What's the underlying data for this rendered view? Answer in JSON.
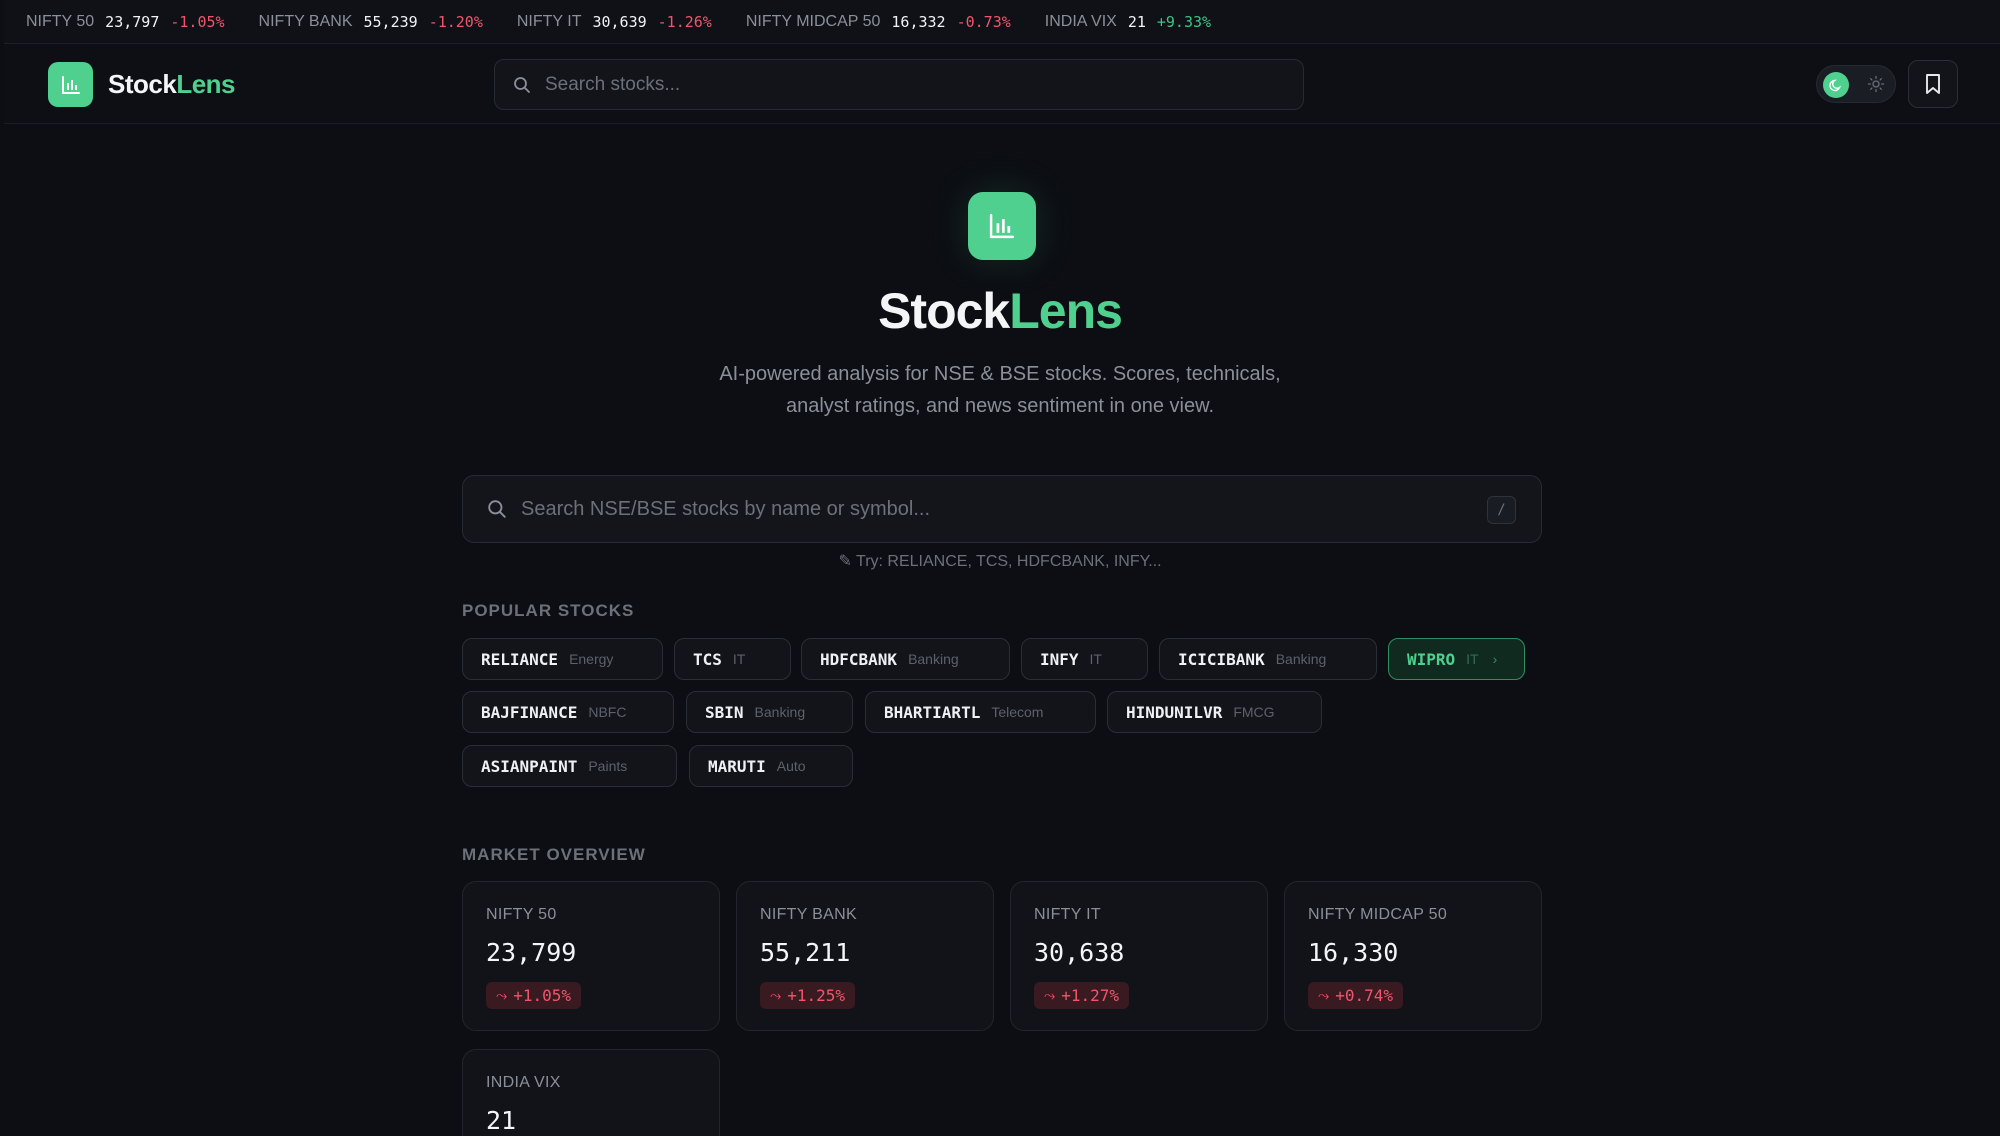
{
  "ticker": [
    {
      "name": "NIFTY 50",
      "value": "23,797",
      "change": "-1.05%",
      "dir": "neg"
    },
    {
      "name": "NIFTY BANK",
      "value": "55,239",
      "change": "-1.20%",
      "dir": "neg"
    },
    {
      "name": "NIFTY IT",
      "value": "30,639",
      "change": "-1.26%",
      "dir": "neg"
    },
    {
      "name": "NIFTY MIDCAP 50",
      "value": "16,332",
      "change": "-0.73%",
      "dir": "neg"
    },
    {
      "name": "INDIA VIX",
      "value": "21",
      "change": "+9.33%",
      "dir": "pos"
    }
  ],
  "header": {
    "brand_a": "Stock",
    "brand_b": "Lens",
    "search_placeholder": "Search stocks..."
  },
  "hero": {
    "title_a": "Stock",
    "title_b": "Lens",
    "subtitle": "AI-powered analysis for NSE & BSE stocks. Scores, technicals, analyst ratings, and news sentiment in one view.",
    "search_placeholder": "Search NSE/BSE stocks by name or symbol...",
    "shortcut": "/",
    "hint": "✎ Try: RELIANCE, TCS, HDFCBANK, INFY..."
  },
  "popular": {
    "label": "POPULAR STOCKS",
    "stocks": [
      {
        "symbol": "RELIANCE",
        "sector": "Energy"
      },
      {
        "symbol": "TCS",
        "sector": "IT"
      },
      {
        "symbol": "HDFCBANK",
        "sector": "Banking"
      },
      {
        "symbol": "INFY",
        "sector": "IT"
      },
      {
        "symbol": "ICICIBANK",
        "sector": "Banking"
      },
      {
        "symbol": "WIPRO",
        "sector": "IT"
      },
      {
        "symbol": "BAJFINANCE",
        "sector": "NBFC"
      },
      {
        "symbol": "SBIN",
        "sector": "Banking"
      },
      {
        "symbol": "BHARTIARTL",
        "sector": "Telecom"
      },
      {
        "symbol": "HINDUNILVR",
        "sector": "FMCG"
      },
      {
        "symbol": "ASIANPAINT",
        "sector": "Paints"
      },
      {
        "symbol": "MARUTI",
        "sector": "Auto"
      }
    ]
  },
  "market": {
    "label": "MARKET OVERVIEW",
    "cards": [
      {
        "name": "NIFTY 50",
        "value": "23,799",
        "change": "+1.05%"
      },
      {
        "name": "NIFTY BANK",
        "value": "55,211",
        "change": "+1.25%"
      },
      {
        "name": "NIFTY IT",
        "value": "30,638",
        "change": "+1.27%"
      },
      {
        "name": "NIFTY MIDCAP 50",
        "value": "16,330",
        "change": "+0.74%"
      },
      {
        "name": "INDIA VIX",
        "value": "21",
        "change": ""
      }
    ]
  },
  "colors": {
    "accent": "#4fd08f",
    "negative": "#f0566b",
    "positive": "#3ec487",
    "background": "#0c0e13"
  },
  "icons": [
    "bar-chart-icon",
    "search-icon",
    "moon-icon",
    "sun-icon",
    "bookmark-icon",
    "trend-down-icon",
    "chevron-right-icon"
  ]
}
